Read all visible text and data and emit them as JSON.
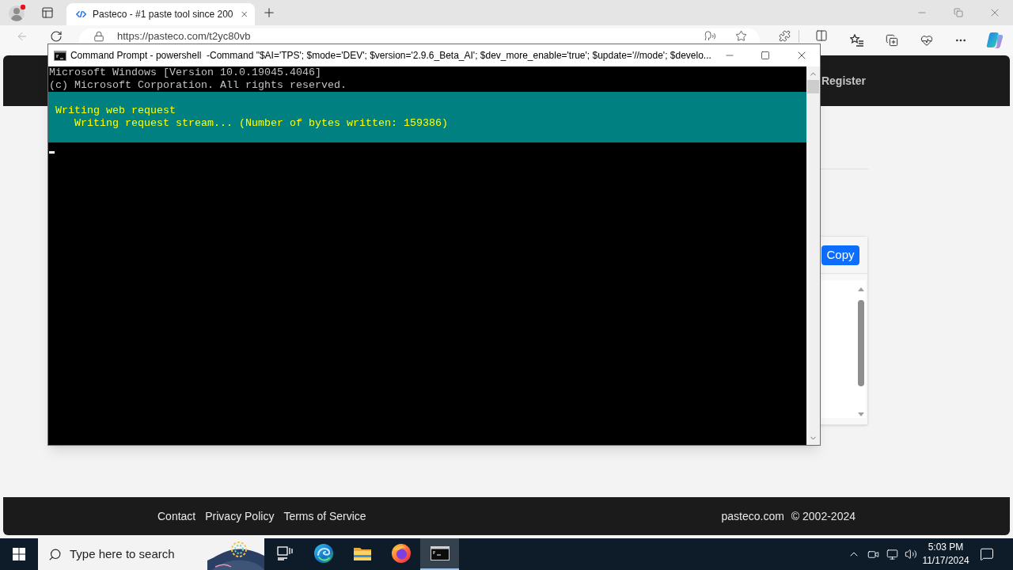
{
  "browser": {
    "tabs": [
      {
        "title": "Pasteco - #1 paste tool since 200",
        "selected": true
      }
    ],
    "address_bar": {
      "url": "https://pasteco.com/t2yc80vb"
    }
  },
  "page": {
    "header": {
      "nav_link": "Register"
    },
    "paste_card": {
      "copy_button": "Copy"
    },
    "footer": {
      "links": [
        "Contact",
        "Privacy Policy",
        "Terms of Service"
      ],
      "site": "pasteco.com",
      "copyright": "© 2002-2024"
    }
  },
  "console_window": {
    "title": "Command Prompt - powershell  -Command \"$AI='TPS'; $mode='DEV'; $version='2.9.6_Beta_AI'; $dev_more_enable='true'; $update='//mode'; $develo...",
    "lines": [
      "Microsoft Windows [Version 10.0.19045.4046]",
      "(c) Microsoft Corporation. All rights reserved."
    ],
    "progress": {
      "activity": "Writing web request",
      "status": "Writing request stream... (Number of bytes written: 159386)"
    }
  },
  "taskbar": {
    "search": {
      "placeholder": "Type here to search"
    },
    "apps": [
      {
        "kind": "task-view",
        "selected": false
      },
      {
        "kind": "edge",
        "selected": false
      },
      {
        "kind": "files",
        "selected": false
      },
      {
        "kind": "firefox",
        "selected": false
      },
      {
        "kind": "terminal",
        "selected": true
      }
    ],
    "clock": {
      "time": "5:03 PM",
      "date": "11/17/2024"
    }
  }
}
